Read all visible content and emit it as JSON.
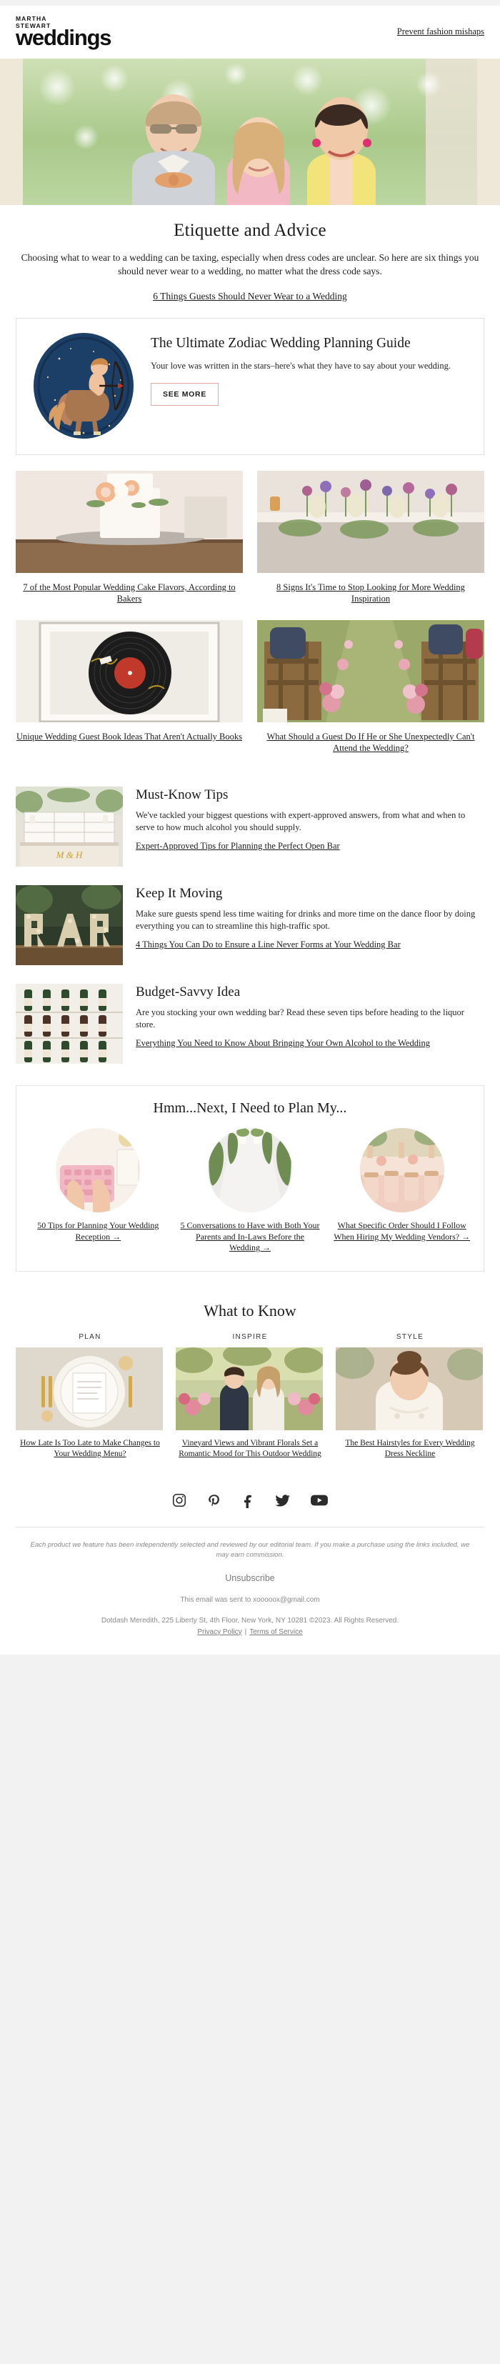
{
  "header": {
    "logo_kicker_line1": "MARTHA",
    "logo_kicker_line2": "STEWART",
    "logo_wordmark": "weddings",
    "header_link": "Prevent fashion mishaps"
  },
  "hero": {
    "alt": "Three wedding guests smiling outdoors in pastel attire"
  },
  "etiquette": {
    "title": "Etiquette and Advice",
    "intro": "Choosing what to wear to a wedding can be taxing, especially when dress codes are unclear. So here are six things you should never wear to a wedding, no matter what the dress code says.",
    "link": "6 Things Guests Should Never Wear to a Wedding"
  },
  "zodiac": {
    "image_alt": "Sagittarius centaur archer illustration on navy circle",
    "title": "The Ultimate Zodiac Wedding Planning Guide",
    "subtitle": "Your love was written in the stars–here's what they have to say about your wedding.",
    "button": "SEE MORE",
    "button_border_color": "#e0a9a0"
  },
  "grid_cards": [
    {
      "image_alt": "White tiered wedding cake with peach roses on wood stand",
      "caption": "7 of the Most Popular Wedding Cake Flavors, According to Bakers"
    },
    {
      "image_alt": "Long reception table with purple and white floral runner",
      "caption": "8 Signs It's Time to Stop Looking for More Wedding Inspiration"
    },
    {
      "image_alt": "Framed signed vinyl record used as a guest book",
      "caption": "Unique Wedding Guest Book Ideas That Aren't Actually Books"
    },
    {
      "image_alt": "Outdoor ceremony aisle lined with pink flowers and wooden chairs",
      "caption": "What Should a Guest Do If He or She Unexpectedly Can't Attend the Wedding?"
    }
  ],
  "tips": [
    {
      "image_alt": "White wedding bar with monogram and greenery",
      "title": "Must-Know Tips",
      "text": "We've tackled your biggest questions with expert-approved answers, from what and when to serve to how much alcohol you should supply.",
      "link": "Expert-Approved Tips for Planning the Perfect Open Bar"
    },
    {
      "image_alt": "Large floral letters spelling BAR on a wooden table",
      "title": "Keep It Moving",
      "text": "Make sure guests spend less time waiting for drinks and more time on the dance floor by doing everything you can to streamline this high-traffic spot.",
      "link": "4 Things You Can Do to Ensure a Line Never Forms at Your Wedding Bar"
    },
    {
      "image_alt": "Wall display of wine bottles arranged in a grid",
      "title": "Budget-Savvy Idea",
      "text": "Are you stocking your own wedding bar? Read these seven tips before heading to the liquor store.",
      "link": "Everything You Need to Know About Bringing Your Own Alcohol to the Wedding"
    }
  ],
  "plan": {
    "title": "Hmm...Next, I Need to Plan My...",
    "items": [
      {
        "image_alt": "Hands typing on a pink keyboard with stationery",
        "caption": "50 Tips for Planning Your Wedding Reception →"
      },
      {
        "image_alt": "White aisle flanked by tall greenery arrangements",
        "caption": "5 Conversations to Have with Both Your Parents and In-Laws Before the Wedding →"
      },
      {
        "image_alt": "Blush reception tablescape with gold chairs and florals",
        "caption": "What Specific Order Should I Follow When Hiring My Wedding Vendors? →"
      }
    ]
  },
  "what_to_know": {
    "title": "What to Know",
    "columns": [
      {
        "kicker": "PLAN",
        "image_alt": "Place setting with menu card and gold flatware",
        "caption": "How Late Is Too Late to Make Changes to Your Wedding Menu?"
      },
      {
        "kicker": "INSPIRE",
        "image_alt": "Couple in a vineyard with floral arrangements",
        "caption": "Vineyard Views and Vibrant Florals Set a Romantic Mood for This Outdoor Wedding"
      },
      {
        "kicker": "STYLE",
        "image_alt": "Bride with updo hairstyle and lace gown neckline",
        "caption": "The Best Hairstyles for Every Wedding Dress Neckline"
      }
    ]
  },
  "social": [
    {
      "name": "instagram-icon",
      "label": "Instagram"
    },
    {
      "name": "pinterest-icon",
      "label": "Pinterest"
    },
    {
      "name": "facebook-icon",
      "label": "Facebook"
    },
    {
      "name": "twitter-icon",
      "label": "Twitter"
    },
    {
      "name": "youtube-icon",
      "label": "YouTube"
    }
  ],
  "footer": {
    "disclaimer": "Each product we feature has been independently selected and reviewed by our editorial team. If you make a purchase using the links included, we may earn commission.",
    "unsubscribe": "Unsubscribe",
    "sent_to": "This email was sent to xooooox@gmail.com",
    "address": "Dotdash Meredith, 225 Liberty St, 4th Floor, New York, NY 10281 ©2023. All Rights Reserved.",
    "privacy": "Privacy Policy",
    "separator": "|",
    "terms": "Terms of Service"
  }
}
